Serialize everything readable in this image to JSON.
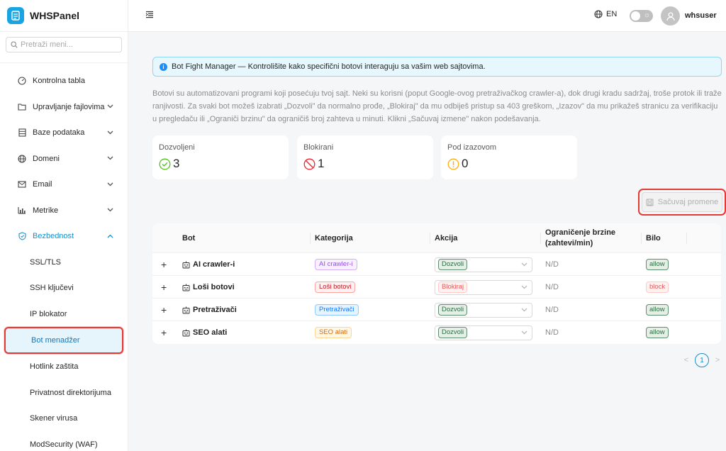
{
  "brand": {
    "name": "WHSPanel"
  },
  "sidebar": {
    "search_placeholder": "Pretraži meni...",
    "items": [
      {
        "label": "Kontrolna tabla",
        "icon": "dashboard-icon",
        "has_chevron": false
      },
      {
        "label": "Upravljanje fajlovima",
        "icon": "folder-icon",
        "has_chevron": true
      },
      {
        "label": "Baze podataka",
        "icon": "database-icon",
        "has_chevron": true
      },
      {
        "label": "Domeni",
        "icon": "globe-icon",
        "has_chevron": true
      },
      {
        "label": "Email",
        "icon": "mail-icon",
        "has_chevron": true
      },
      {
        "label": "Metrike",
        "icon": "bar-chart-icon",
        "has_chevron": true
      },
      {
        "label": "Bezbednost",
        "icon": "shield-icon",
        "has_chevron": true,
        "expanded": true
      }
    ],
    "security_sub": [
      {
        "label": "SSL/TLS"
      },
      {
        "label": "SSH ključevi"
      },
      {
        "label": "IP blokator"
      },
      {
        "label": "Bot menadžer",
        "selected": true
      },
      {
        "label": "Hotlink zaštita"
      },
      {
        "label": "Privatnost direktorijuma"
      },
      {
        "label": "Skener virusa"
      },
      {
        "label": "ModSecurity (WAF)"
      }
    ]
  },
  "header": {
    "language": "EN",
    "username": "whsuser"
  },
  "alert": {
    "text": "Bot Fight Manager — Kontrolišite kako specifični botovi interaguju sa vašim web sajtovima."
  },
  "description": "Botovi su automatizovani programi koji posećuju tvoj sajt. Neki su korisni (poput Google-ovog pretraživačkog crawler-a), dok drugi kradu sadržaj, troše protok ili traže ranjivosti. Za svaki bot možeš izabrati „Dozvoli\" da normalno prođe, „Blokiraj\" da mu odbiješ pristup sa 403 greškom, „Izazov\" da mu prikažeš stranicu za verifikaciju u pregledaču ili „Ograniči brzinu\" da ograničiš broj zahteva u minuti. Klikni „Sačuvaj izmene\" nakon podešavanja.",
  "stats": [
    {
      "title": "Dozvoljeni",
      "value": "3",
      "color": "#52c41a"
    },
    {
      "title": "Blokirani",
      "value": "1",
      "color": "#f5222d"
    },
    {
      "title": "Pod izazovom",
      "value": "0",
      "color": "#faad14"
    }
  ],
  "save_button": {
    "label": "Sačuvaj promene",
    "disabled": true
  },
  "table": {
    "columns": {
      "bot": "Bot",
      "category": "Kategorija",
      "action": "Akcija",
      "rate_line1": "Ograničenje brzine",
      "rate_line2": "(zahtevi/min)",
      "was": "Bilo"
    },
    "rows": [
      {
        "name": "AI crawler-i",
        "category": "AI crawler-i",
        "category_style": "purple",
        "action": "Dozvoli",
        "action_style": "green",
        "rate": "N/D",
        "was": "allow",
        "was_style": "green"
      },
      {
        "name": "Loši botovi",
        "category": "Loši botovi",
        "category_style": "red",
        "action": "Blokiraj",
        "action_style": "redp",
        "rate": "N/D",
        "was": "block",
        "was_style": "redp"
      },
      {
        "name": "Pretraživači",
        "category": "Pretraživači",
        "category_style": "blue",
        "action": "Dozvoli",
        "action_style": "green",
        "rate": "N/D",
        "was": "allow",
        "was_style": "green"
      },
      {
        "name": "SEO alati",
        "category": "SEO alati",
        "category_style": "orange",
        "action": "Dozvoli",
        "action_style": "green",
        "rate": "N/D",
        "was": "allow",
        "was_style": "green"
      }
    ]
  },
  "pagination": {
    "current": "1",
    "prev": "<",
    "next": ">"
  }
}
